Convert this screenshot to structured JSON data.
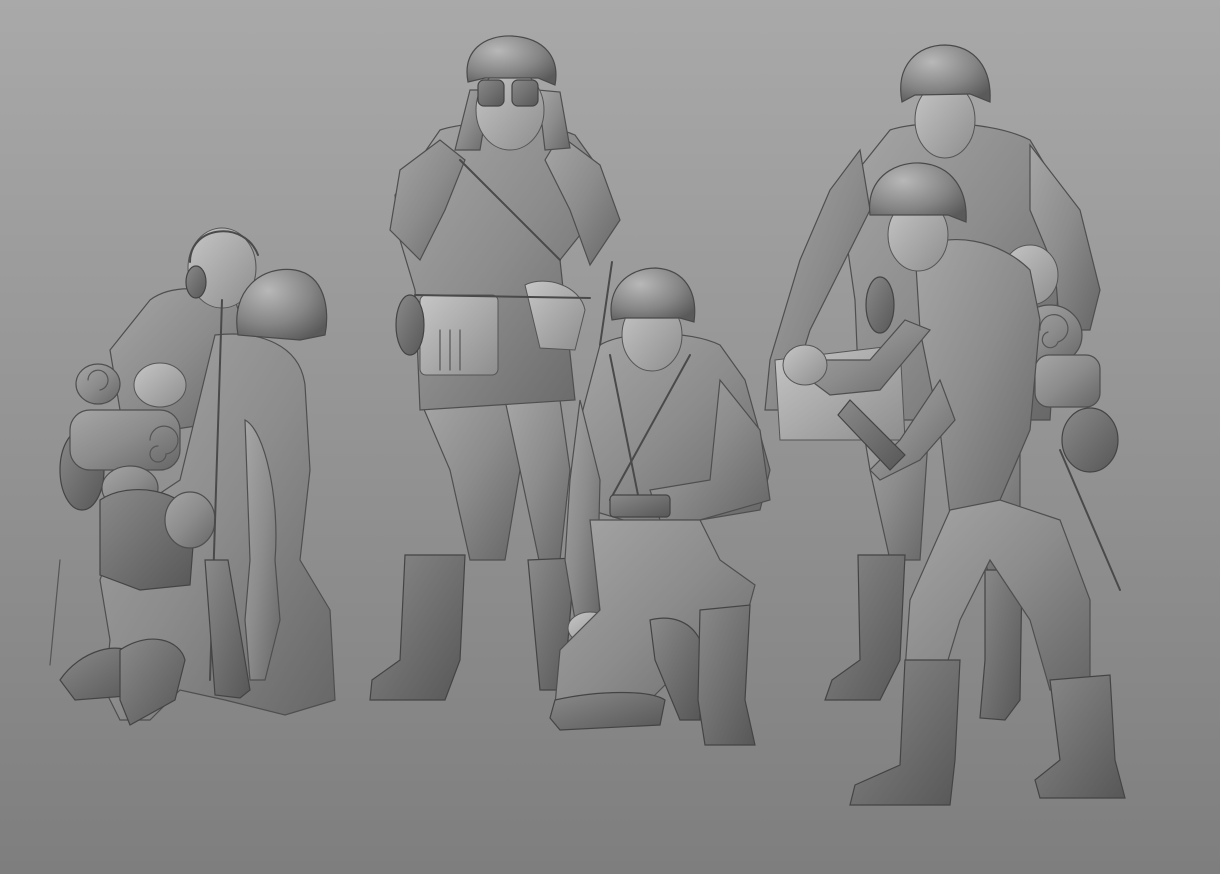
{
  "scene": {
    "background_top": "#a9a9a9",
    "background_bottom": "#7e7e7e",
    "clay_base": "#8c8c8c",
    "clay_shadow": "#5e5e5e",
    "clay_highlight": "#bdbdbd"
  },
  "figures": [
    {
      "name": "kneeling-radio-operator-pair"
    },
    {
      "name": "standing-soldier-with-binoculars"
    },
    {
      "name": "kneeling-soldier"
    },
    {
      "name": "officer-with-map-case"
    },
    {
      "name": "soldier-with-grenade"
    }
  ]
}
